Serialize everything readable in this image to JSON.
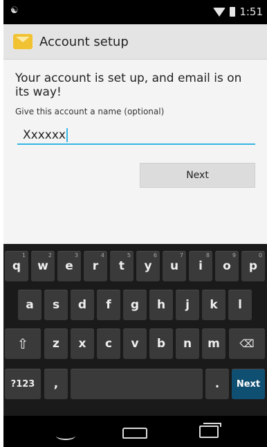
{
  "status_bar": {
    "time": "1:51",
    "left_icon": "usb-debug-icon"
  },
  "action_bar": {
    "title": "Account setup",
    "icon": "email-icon"
  },
  "content": {
    "message": "Your account is set up, and email is on its way!",
    "hint": "Give this account a name (optional)",
    "account_name_value": "Xxxxxx",
    "next_button": "Next"
  },
  "keyboard": {
    "row1": [
      {
        "k": "q",
        "n": "1"
      },
      {
        "k": "w",
        "n": "2"
      },
      {
        "k": "e",
        "n": "3"
      },
      {
        "k": "r",
        "n": "4"
      },
      {
        "k": "t",
        "n": "5"
      },
      {
        "k": "y",
        "n": "6"
      },
      {
        "k": "u",
        "n": "7"
      },
      {
        "k": "i",
        "n": "8"
      },
      {
        "k": "o",
        "n": "9"
      },
      {
        "k": "p",
        "n": "0"
      }
    ],
    "row2": [
      "a",
      "s",
      "d",
      "f",
      "g",
      "h",
      "j",
      "k",
      "l"
    ],
    "row3": [
      "z",
      "x",
      "c",
      "v",
      "b",
      "n",
      "m"
    ],
    "shift_icon": "shift-icon",
    "backspace_icon": "backspace-icon",
    "symbols_label": "?123",
    "comma_label": ",",
    "period_label": ".",
    "next_label": "Next"
  },
  "nav_bar": {
    "back_icon": "back-icon",
    "home_icon": "home-icon",
    "recents_icon": "recents-icon"
  }
}
